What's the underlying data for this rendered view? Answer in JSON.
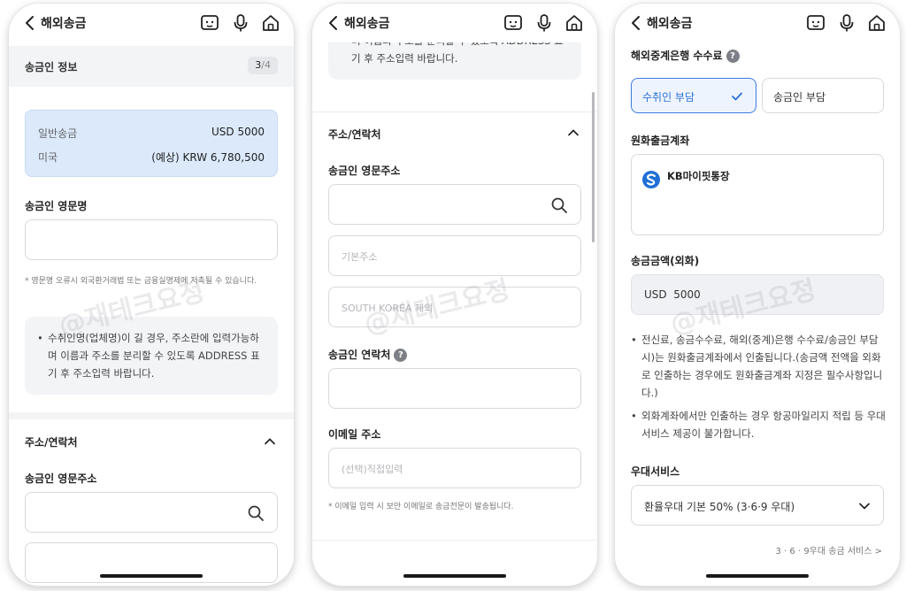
{
  "common": {
    "title": "해외송금",
    "watermark": "@재테크요정"
  },
  "icons": {
    "back": "chevron-left-icon",
    "chat": "chatbot-icon",
    "mic": "microphone-icon",
    "home": "home-icon"
  },
  "colors": {
    "accent": "#3d7be0",
    "summary_bg": "#dbe9fb",
    "bank_logo": "#1f6fd6"
  },
  "phone1": {
    "section": {
      "label": "송금인 정보",
      "step_current": "3",
      "step_sep": "/",
      "step_total": "4"
    },
    "summary": {
      "type_label": "일반송금",
      "send_amount": "USD 5000",
      "country": "미국",
      "krw_amount": "(예상) KRW 6,780,500"
    },
    "english_name": {
      "label": "송금인 영문명",
      "value": ""
    },
    "name_note": "* 영문명 오류시 외국환거래법 또는 금융실명제에 저촉될 수 있습니다.",
    "info_text": "수취인명(업체명)이 길 경우, 주소란에 입력가능하며 이름과 주소를 분리할 수 있도록 ADDRESS 표기 후 주소입력 바랍니다.",
    "address_section": {
      "title": "주소/연락처"
    },
    "address": {
      "label": "송금인 영문주소",
      "value": ""
    }
  },
  "phone2": {
    "info_text_tail": "며 이름과 주소를 분리할 수 있도록 ADDRESS 표기 후 주소입력 바랍니다.",
    "address_section": {
      "title": "주소/연락처"
    },
    "address": {
      "label": "송금인 영문주소",
      "search_value": "",
      "basic_placeholder": "기본주소",
      "country_placeholder": "SOUTH KOREA 제외"
    },
    "contact": {
      "label": "송금인 연락처",
      "value": ""
    },
    "email": {
      "label": "이메일 주소",
      "placeholder": "(선택)직접입력"
    },
    "email_note": "* 이메일 입력 시 보안 이메일로 송금전문이 발송됩니다."
  },
  "phone3": {
    "fee": {
      "label": "해외중계은행 수수료",
      "options": [
        "수취인 부담",
        "송금인 부담"
      ],
      "selected": "수취인 부담"
    },
    "withdraw": {
      "label": "원화출금계좌",
      "account_name": "KB마이핏통장"
    },
    "amount": {
      "label": "송금금액(외화)",
      "currency": "USD",
      "value": "5000"
    },
    "notes": [
      "전신료, 송금수수료, 해외(중계)은행 수수료/송금인 부담 시)는 원화출금계좌에서 인출됩니다.(송금액 전액을 외화로 인출하는 경우에도 원화출금계좌 지정은 필수사항입니다.)",
      "외화계좌에서만 인출하는 경우 항공마일리지 적립 등 우대 서비스 제공이 불가합니다."
    ],
    "benefit": {
      "label": "우대서비스",
      "selected": "환율우대 기본 50% (3·6·9 우대)",
      "link": "3 · 6 · 9우대 송금 서비스 >"
    }
  }
}
